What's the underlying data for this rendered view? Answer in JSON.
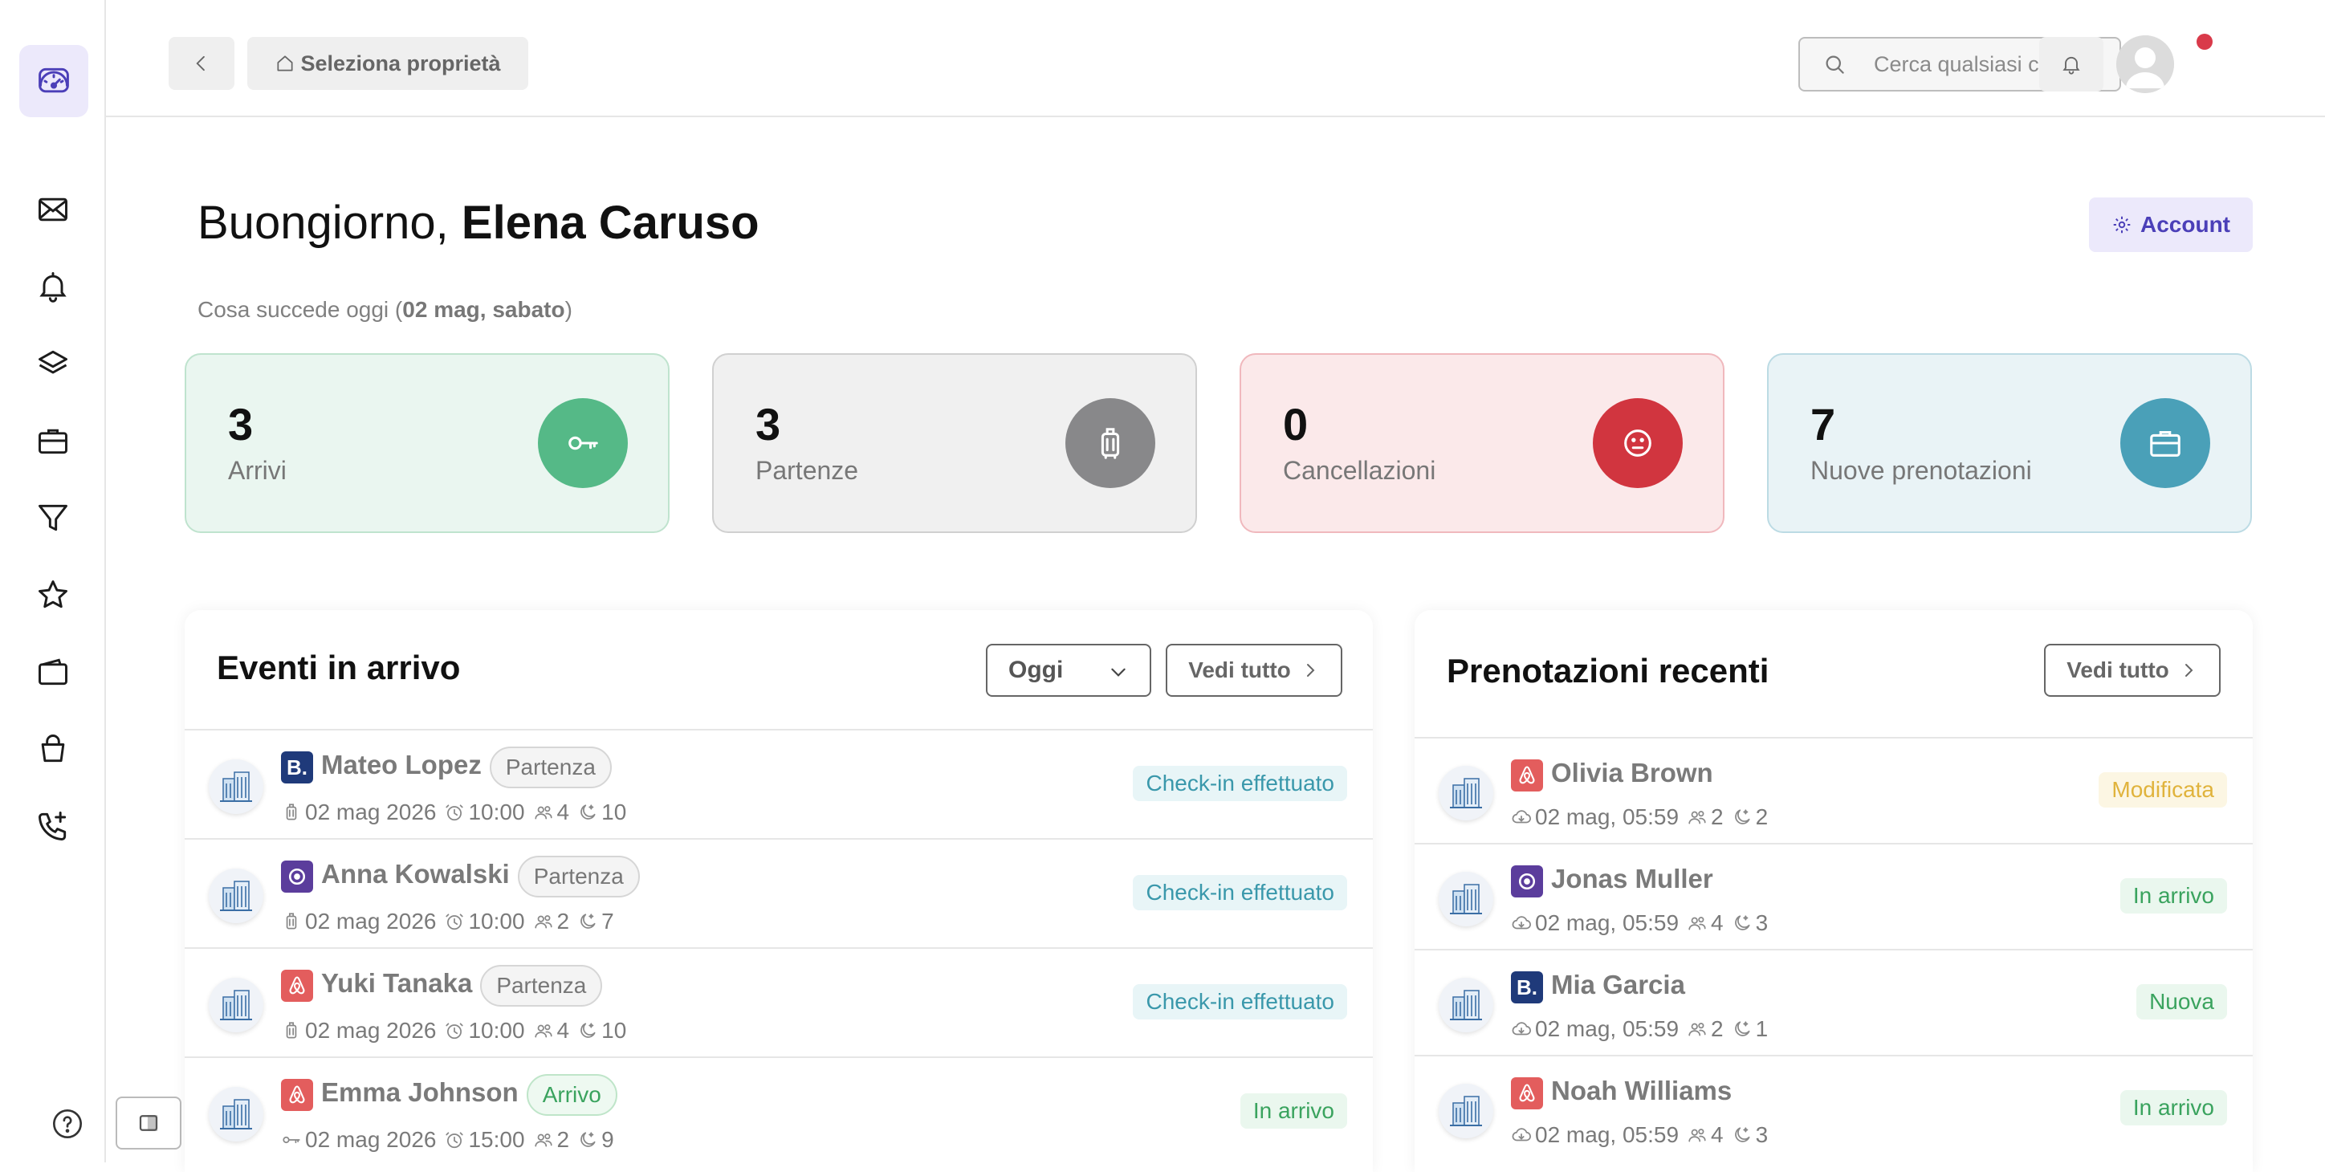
{
  "sidebar": {
    "items": [
      {
        "name": "dashboard-icon",
        "active": true
      },
      {
        "name": "mail-icon"
      },
      {
        "name": "bell-icon"
      },
      {
        "name": "layers-icon"
      },
      {
        "name": "briefcase-icon"
      },
      {
        "name": "filter-icon"
      },
      {
        "name": "star-icon"
      },
      {
        "name": "wallet-icon"
      },
      {
        "name": "bag-icon"
      },
      {
        "name": "phone-plus-icon"
      }
    ],
    "help_icon": "help-icon",
    "toggle_icon": "sidebar-toggle-icon"
  },
  "topbar": {
    "back_icon": "chevron-left-icon",
    "property_label": "Seleziona proprietà",
    "search_placeholder": "Cerca qualsiasi cosa...",
    "has_notifications": true
  },
  "header": {
    "greeting_prefix": "Buongiorno, ",
    "user_name": "Elena Caruso",
    "account_label": "Account",
    "subtitle_prefix": "Cosa succede oggi (",
    "subtitle_date": "02 mag, sabato",
    "subtitle_suffix": ")"
  },
  "stats": [
    {
      "value": "3",
      "label": "Arrivi",
      "icon": "key-icon",
      "color": "#55b987"
    },
    {
      "value": "3",
      "label": "Partenze",
      "icon": "luggage-icon",
      "color": "#88888a"
    },
    {
      "value": "0",
      "label": "Cancellazioni",
      "icon": "sad-face-icon",
      "color": "#d1353f"
    },
    {
      "value": "7",
      "label": "Nuove prenotazioni",
      "icon": "briefcase-icon",
      "color": "#4aa0b8"
    }
  ],
  "events": {
    "title": "Eventi in arrivo",
    "filter_value": "Oggi",
    "see_all": "Vedi tutto",
    "rows": [
      {
        "channel": "booking",
        "name": "Mateo Lopez",
        "tag": "Partenza",
        "date": "02 mag 2026",
        "time": "10:00",
        "guests": "4",
        "nights": "10",
        "status": "Check-in effettuato"
      },
      {
        "channel": "vrbo",
        "name": "Anna Kowalski",
        "tag": "Partenza",
        "date": "02 mag 2026",
        "time": "10:00",
        "guests": "2",
        "nights": "7",
        "status": "Check-in effettuato"
      },
      {
        "channel": "airbnb",
        "name": "Yuki Tanaka",
        "tag": "Partenza",
        "date": "02 mag 2026",
        "time": "10:00",
        "guests": "4",
        "nights": "10",
        "status": "Check-in effettuato"
      },
      {
        "channel": "airbnb",
        "name": "Emma Johnson",
        "tag": "Arrivo",
        "date": "02 mag 2026",
        "time": "15:00",
        "guests": "2",
        "nights": "9",
        "status": "In arrivo"
      }
    ]
  },
  "bookings": {
    "title": "Prenotazioni recenti",
    "see_all": "Vedi tutto",
    "rows": [
      {
        "channel": "airbnb",
        "name": "Olivia Brown",
        "date": "02 mag, 05:59",
        "guests": "2",
        "nights": "2",
        "status": "Modificata"
      },
      {
        "channel": "vrbo",
        "name": "Jonas Muller",
        "date": "02 mag, 05:59",
        "guests": "4",
        "nights": "3",
        "status": "In arrivo"
      },
      {
        "channel": "booking",
        "name": "Mia Garcia",
        "date": "02 mag, 05:59",
        "guests": "2",
        "nights": "1",
        "status": "Nuova"
      },
      {
        "channel": "airbnb",
        "name": "Noah Williams",
        "date": "02 mag, 05:59",
        "guests": "4",
        "nights": "3",
        "status": "In arrivo"
      }
    ]
  },
  "channel_colors": {
    "booking": "#1f3a7a",
    "vrbo": "#5b3d9c",
    "airbnb": "#e35d5d"
  },
  "booking_letter": "B."
}
